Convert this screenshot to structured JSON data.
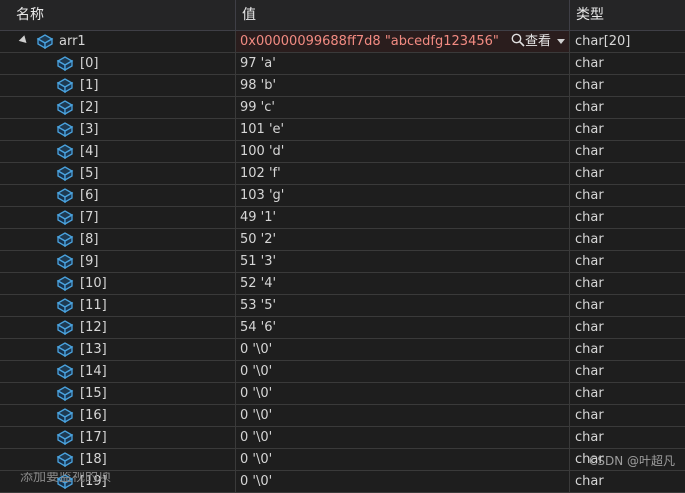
{
  "header": {
    "name": "名称",
    "value": "值",
    "type": "类型"
  },
  "parent": {
    "name": "arr1",
    "value": "0x00000099688ff7d8 \"abcedfg123456\"",
    "viewer_label": "查看",
    "type": "char[20]"
  },
  "items": [
    {
      "name": "[0]",
      "value": "97 'a'",
      "type": "char"
    },
    {
      "name": "[1]",
      "value": "98 'b'",
      "type": "char"
    },
    {
      "name": "[2]",
      "value": "99 'c'",
      "type": "char"
    },
    {
      "name": "[3]",
      "value": "101 'e'",
      "type": "char"
    },
    {
      "name": "[4]",
      "value": "100 'd'",
      "type": "char"
    },
    {
      "name": "[5]",
      "value": "102 'f'",
      "type": "char"
    },
    {
      "name": "[6]",
      "value": "103 'g'",
      "type": "char"
    },
    {
      "name": "[7]",
      "value": "49 '1'",
      "type": "char"
    },
    {
      "name": "[8]",
      "value": "50 '2'",
      "type": "char"
    },
    {
      "name": "[9]",
      "value": "51 '3'",
      "type": "char"
    },
    {
      "name": "[10]",
      "value": "52 '4'",
      "type": "char"
    },
    {
      "name": "[11]",
      "value": "53 '5'",
      "type": "char"
    },
    {
      "name": "[12]",
      "value": "54 '6'",
      "type": "char"
    },
    {
      "name": "[13]",
      "value": "0 '\\0'",
      "type": "char"
    },
    {
      "name": "[14]",
      "value": "0 '\\0'",
      "type": "char"
    },
    {
      "name": "[15]",
      "value": "0 '\\0'",
      "type": "char"
    },
    {
      "name": "[16]",
      "value": "0 '\\0'",
      "type": "char"
    },
    {
      "name": "[17]",
      "value": "0 '\\0'",
      "type": "char"
    },
    {
      "name": "[18]",
      "value": "0 '\\0'",
      "type": "char"
    },
    {
      "name": "[19]",
      "value": "0 '\\0'",
      "type": "char"
    }
  ],
  "add_watch_placeholder": "添加要监视的项",
  "watermark": "CSDN @叶超凡",
  "colors": {
    "background": "#1e1e1e",
    "value_highlight": "#f28b82",
    "icon": "#4aa3df"
  },
  "icons": {
    "expand": "collapse-triangle-icon",
    "variable": "variable-cube-icon",
    "magnifier": "search-icon",
    "dropdown": "chevron-down-icon"
  }
}
